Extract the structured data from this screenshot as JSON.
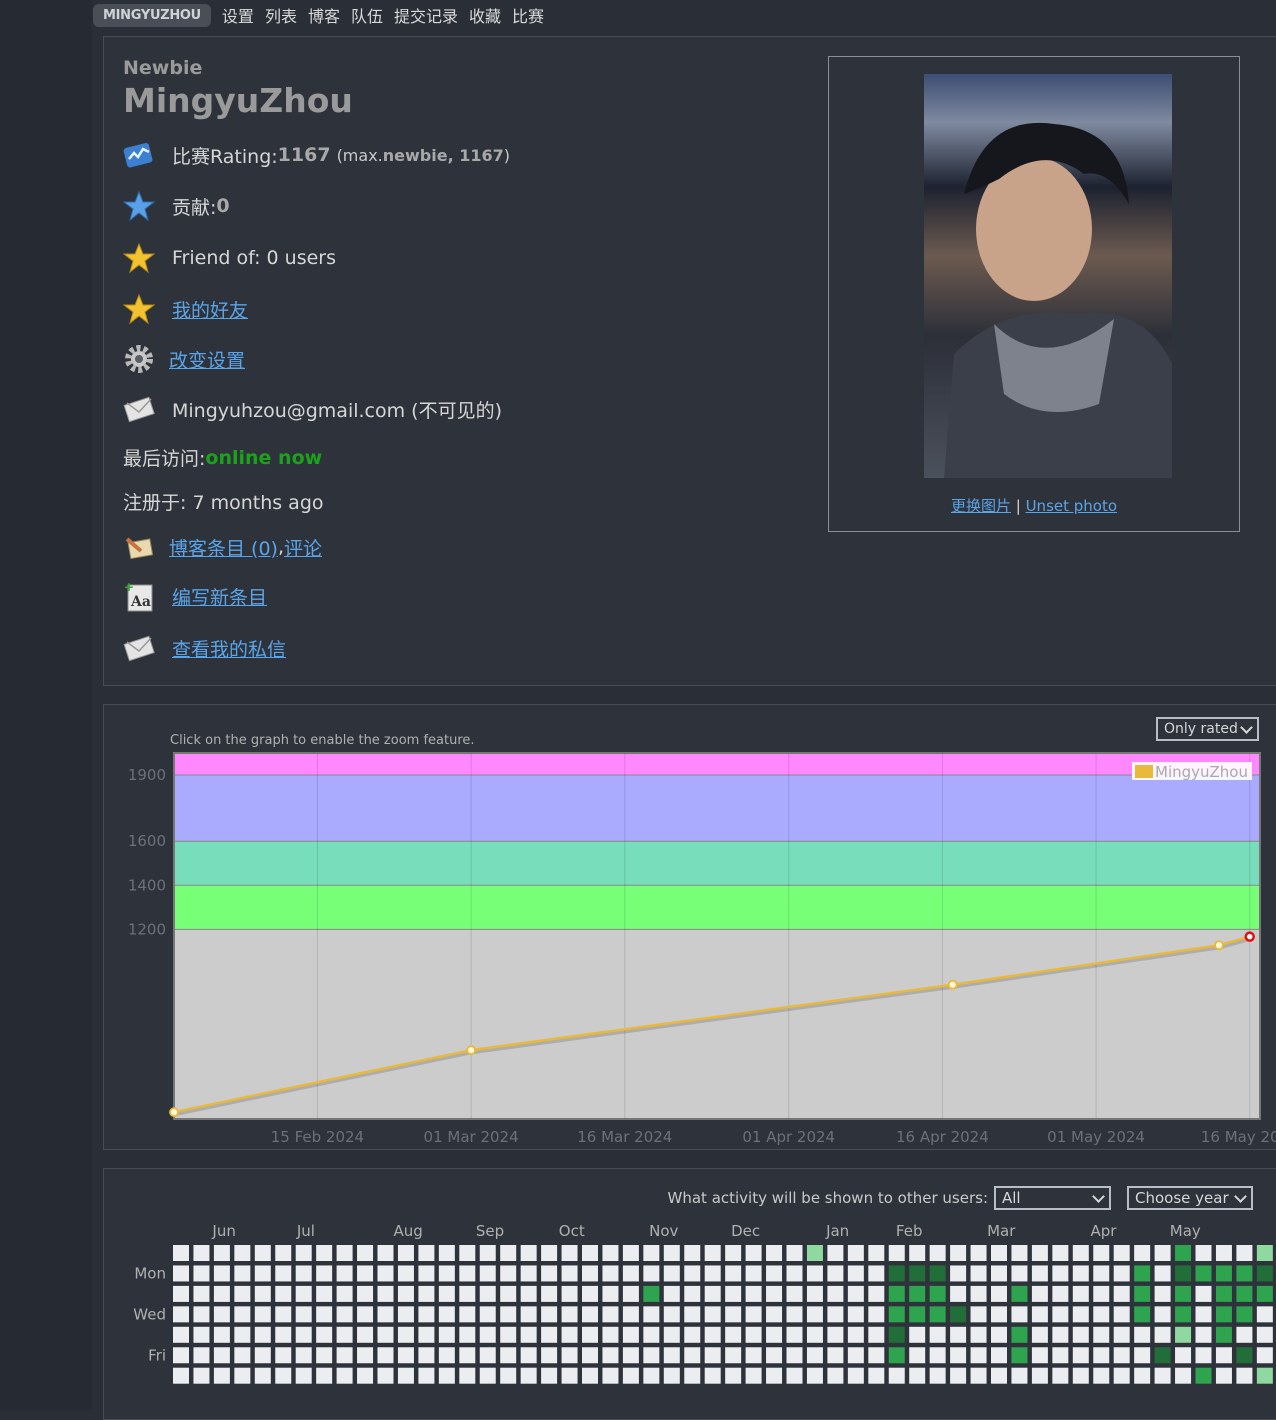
{
  "nav": {
    "user_badge": "MINGYUZHOU",
    "items": [
      "设置",
      "列表",
      "博客",
      "队伍",
      "提交记录",
      "收藏",
      "比赛"
    ]
  },
  "profile": {
    "rank": "Newbie",
    "handle": "MingyuZhou",
    "rating_label": "比赛Rating: ",
    "rating_value": "1167",
    "rating_max_prefix": "(max. ",
    "rating_max_rank": "newbie, 1167",
    "rating_max_suffix": ")",
    "contribution_label": "贡献: ",
    "contribution_value": "0",
    "friend_of": "Friend of: 0 users",
    "my_friends": "我的好友",
    "change_settings": "改变设置",
    "email": "Mingyuhzou@gmail.com (不可见的)",
    "last_visit_label": "最后访问: ",
    "last_visit_value": "online now",
    "registered": "注册于: 7 months ago",
    "blog_entries": "博客条目 (0)",
    "comma": ", ",
    "comments": "评论",
    "write_entry": "编写新条目",
    "view_messages": "查看我的私信",
    "change_photo": "更换图片",
    "separator": " | ",
    "unset_photo": "Unset photo"
  },
  "icons": {
    "rating": "rating-chart-icon",
    "contribution": "blue-star-icon",
    "friend_of": "gold-star-icon",
    "my_friends": "gold-star-icon",
    "settings": "gear-icon",
    "email": "envelope-icon",
    "blog": "pencil-paper-icon",
    "write": "new-text-icon",
    "messages": "envelope-icon"
  },
  "graph": {
    "hint": "Click on the graph to enable the zoom feature.",
    "filter_value": "Only rated",
    "legend": "MingyuZhou",
    "line_color": "#e8b93a"
  },
  "chart_data": {
    "type": "line",
    "x": [
      "2024-02-01",
      "2024-03-01",
      "2024-04-17",
      "2024-05-13",
      "2024-05-16"
    ],
    "series": [
      {
        "name": "MingyuZhou",
        "values": [
          371,
          652,
          949,
          1128,
          1167
        ]
      }
    ],
    "xticks": [
      "15 Feb 2024",
      "01 Mar 2024",
      "16 Mar 2024",
      "01 Apr 2024",
      "16 Apr 2024",
      "01 May 2024",
      "16 May 2024"
    ],
    "yticks": [
      1200,
      1400,
      1600,
      1900
    ],
    "ylim": [
      340,
      2000
    ],
    "bands": [
      {
        "from": 340,
        "to": 1200,
        "color": "#cccccc"
      },
      {
        "from": 1200,
        "to": 1400,
        "color": "#77ff77"
      },
      {
        "from": 1400,
        "to": 1600,
        "color": "#77ddbb"
      },
      {
        "from": 1600,
        "to": 1900,
        "color": "#aaaaff"
      },
      {
        "from": 1900,
        "to": 2000,
        "color": "#ff88ff"
      }
    ]
  },
  "heatmap": {
    "visibility_label": "What activity will be shown to other users:",
    "visibility_value": "All",
    "year_value": "Choose year",
    "months": [
      "Jun",
      "Jul",
      "Aug",
      "Sep",
      "Oct",
      "Nov",
      "Dec",
      "Jan",
      "Feb",
      "Mar",
      "Apr",
      "May"
    ],
    "day_labels": [
      "Mon",
      "Wed",
      "Fri"
    ],
    "active_cells": [
      {
        "w": 31,
        "d": 0,
        "level": 1
      },
      {
        "w": 23,
        "d": 2,
        "level": 3
      },
      {
        "w": 35,
        "d": 1,
        "level": 4
      },
      {
        "w": 35,
        "d": 2,
        "level": 3
      },
      {
        "w": 35,
        "d": 3,
        "level": 3
      },
      {
        "w": 35,
        "d": 4,
        "level": 4
      },
      {
        "w": 35,
        "d": 5,
        "level": 3
      },
      {
        "w": 36,
        "d": 1,
        "level": 4
      },
      {
        "w": 36,
        "d": 2,
        "level": 3
      },
      {
        "w": 36,
        "d": 3,
        "level": 3
      },
      {
        "w": 37,
        "d": 1,
        "level": 4
      },
      {
        "w": 37,
        "d": 2,
        "level": 3
      },
      {
        "w": 37,
        "d": 3,
        "level": 3
      },
      {
        "w": 38,
        "d": 3,
        "level": 4
      },
      {
        "w": 41,
        "d": 2,
        "level": 3
      },
      {
        "w": 41,
        "d": 4,
        "level": 3
      },
      {
        "w": 41,
        "d": 5,
        "level": 3
      },
      {
        "w": 47,
        "d": 1,
        "level": 3
      },
      {
        "w": 47,
        "d": 2,
        "level": 3
      },
      {
        "w": 47,
        "d": 3,
        "level": 3
      },
      {
        "w": 48,
        "d": 5,
        "level": 4
      },
      {
        "w": 49,
        "d": 0,
        "level": 3
      },
      {
        "w": 49,
        "d": 1,
        "level": 4
      },
      {
        "w": 49,
        "d": 2,
        "level": 3
      },
      {
        "w": 49,
        "d": 3,
        "level": 3
      },
      {
        "w": 49,
        "d": 4,
        "level": 1
      },
      {
        "w": 50,
        "d": 1,
        "level": 3
      },
      {
        "w": 50,
        "d": 6,
        "level": 3
      },
      {
        "w": 51,
        "d": 1,
        "level": 3
      },
      {
        "w": 51,
        "d": 2,
        "level": 3
      },
      {
        "w": 51,
        "d": 3,
        "level": 3
      },
      {
        "w": 51,
        "d": 4,
        "level": 3
      },
      {
        "w": 52,
        "d": 1,
        "level": 3
      },
      {
        "w": 52,
        "d": 2,
        "level": 3
      },
      {
        "w": 52,
        "d": 3,
        "level": 3
      },
      {
        "w": 52,
        "d": 5,
        "level": 4
      },
      {
        "w": 53,
        "d": 0,
        "level": 1
      },
      {
        "w": 53,
        "d": 1,
        "level": 4
      },
      {
        "w": 53,
        "d": 2,
        "level": 3
      },
      {
        "w": 53,
        "d": 6,
        "level": 1
      }
    ]
  }
}
